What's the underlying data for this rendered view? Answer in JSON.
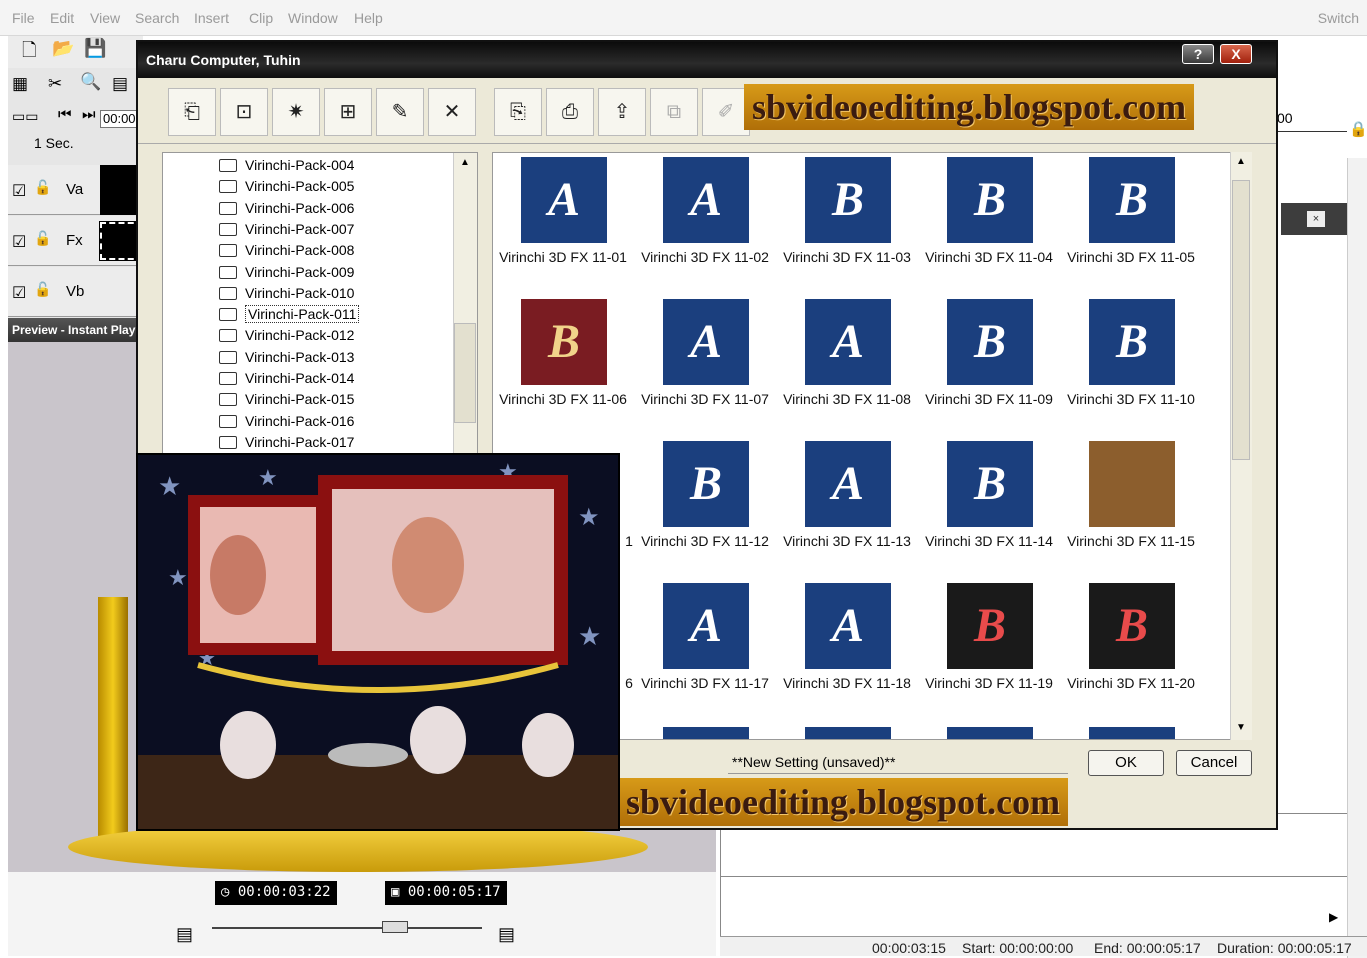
{
  "menu": [
    "File",
    "Edit",
    "View",
    "Search",
    "Insert",
    "Clip",
    "Window",
    "Help"
  ],
  "switch_label": "Switch",
  "timeline": {
    "scale_label": "1 Sec.",
    "time_field": "00:00",
    "tracks": [
      {
        "label": "Va"
      },
      {
        "label": "Fx"
      },
      {
        "label": "Vb"
      }
    ]
  },
  "right_timefield": "00",
  "preview": {
    "title": "Preview - Instant Play",
    "current_time": "00:00:03:22",
    "total_time": "00:00:05:17"
  },
  "status": {
    "position": "00:00:03:15",
    "start": "Start: 00:00:00:00",
    "end": "End: 00:00:05:17",
    "duration": "Duration: 00:00:05:17"
  },
  "dialog": {
    "title": "Charu Computer, Tuhin",
    "help_btn": "?",
    "close_btn": "X",
    "folders": [
      "Virinchi-Pack-004",
      "Virinchi-Pack-005",
      "Virinchi-Pack-006",
      "Virinchi-Pack-007",
      "Virinchi-Pack-008",
      "Virinchi-Pack-009",
      "Virinchi-Pack-010",
      "Virinchi-Pack-011",
      "Virinchi-Pack-012",
      "Virinchi-Pack-013",
      "Virinchi-Pack-014",
      "Virinchi-Pack-015",
      "Virinchi-Pack-016",
      "Virinchi-Pack-017"
    ],
    "selected_folder": "Virinchi-Pack-011",
    "effects": [
      {
        "name": "Virinchi 3D FX 11-01",
        "glyph": "A",
        "style": "blue"
      },
      {
        "name": "Virinchi 3D FX 11-02",
        "glyph": "A",
        "style": "blue"
      },
      {
        "name": "Virinchi 3D FX 11-03",
        "glyph": "B",
        "style": "blue"
      },
      {
        "name": "Virinchi 3D FX 11-04",
        "glyph": "B",
        "style": "blue"
      },
      {
        "name": "Virinchi 3D FX 11-05",
        "glyph": "B",
        "style": "blue"
      },
      {
        "name": "Virinchi 3D FX 11-06",
        "glyph": "B",
        "style": "red"
      },
      {
        "name": "Virinchi 3D FX 11-07",
        "glyph": "A",
        "style": "blue"
      },
      {
        "name": "Virinchi 3D FX 11-08",
        "glyph": "A",
        "style": "blue"
      },
      {
        "name": "Virinchi 3D FX 11-09",
        "glyph": "B",
        "style": "blue"
      },
      {
        "name": "Virinchi 3D FX 11-10",
        "glyph": "B",
        "style": "blue"
      },
      {
        "name": "1",
        "glyph": "",
        "style": "blue"
      },
      {
        "name": "Virinchi 3D FX 11-12",
        "glyph": "B",
        "style": "blue"
      },
      {
        "name": "Virinchi 3D FX 11-13",
        "glyph": "A",
        "style": "blue"
      },
      {
        "name": "Virinchi 3D FX 11-14",
        "glyph": "B",
        "style": "blue"
      },
      {
        "name": "Virinchi 3D FX 11-15",
        "glyph": "",
        "style": "gold"
      },
      {
        "name": "6",
        "glyph": "",
        "style": "blue"
      },
      {
        "name": "Virinchi 3D FX 11-17",
        "glyph": "A",
        "style": "blue"
      },
      {
        "name": "Virinchi 3D FX 11-18",
        "glyph": "A",
        "style": "blue"
      },
      {
        "name": "Virinchi 3D FX 11-19",
        "glyph": "B",
        "style": "dark"
      },
      {
        "name": "Virinchi 3D FX 11-20",
        "glyph": "B",
        "style": "dark"
      }
    ],
    "setting": "**New Setting (unsaved)**",
    "ok": "OK",
    "cancel": "Cancel"
  },
  "watermark": "sbvideoediting.blogspot.com",
  "colors": {
    "dialog_bg": "#ece9d8",
    "thumb_blue": "#1b3f7e",
    "watermark": "#c9850f"
  }
}
